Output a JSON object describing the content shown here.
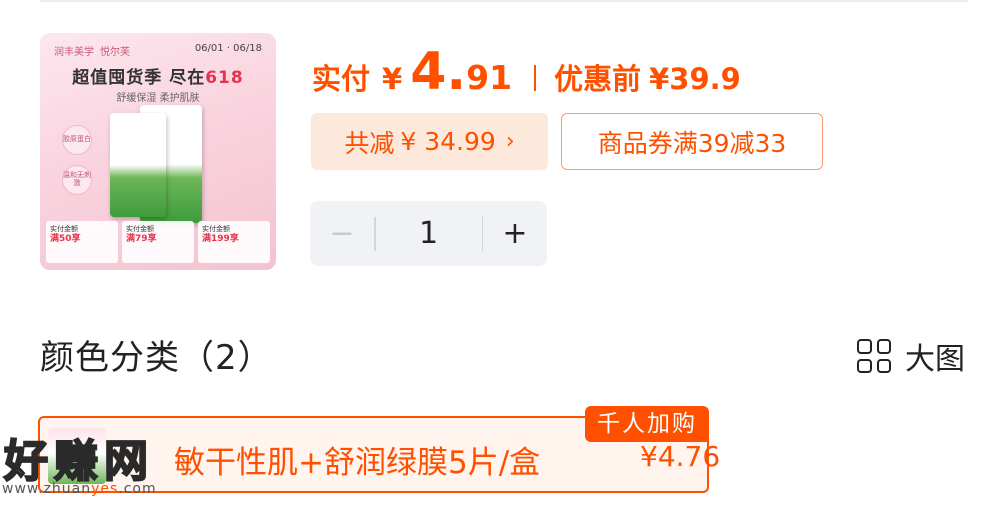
{
  "product_image": {
    "brand_left": "润丰美学",
    "brand_right": "悦尔芙",
    "dates": "06/01 · 06/18",
    "headline_prefix": "超值囤货季 尽在",
    "headline_highlight": "618",
    "subline": "舒缓保湿 柔护肌肤",
    "bubble_1": "胶原蛋白",
    "bubble_2": "温和无刺激",
    "promos": [
      {
        "line1": "实付金额",
        "line2": "满50享"
      },
      {
        "line1": "实付金额",
        "line2": "满79享"
      },
      {
        "line1": "实付金额",
        "line2": "满199享"
      }
    ]
  },
  "price": {
    "label": "实付",
    "currency": "¥",
    "integer": "4.",
    "decimal": "91",
    "original_label": "优惠前",
    "original_value": "¥39.9",
    "color": "#ff5000"
  },
  "discount": {
    "label": "共减",
    "amount": "¥ 34.99",
    "chevron": "›"
  },
  "coupon": {
    "label": "商品券满39减33"
  },
  "quantity": {
    "minus": "−",
    "value": "1",
    "plus": "+"
  },
  "section": {
    "title": "颜色分类（2）",
    "view_label": "大图",
    "view_icon": "grid-icon"
  },
  "variant": {
    "name": "敏干性肌+舒润绿膜5片/盒",
    "price": "¥4.76",
    "badge": "千人加购"
  },
  "watermark": {
    "text": "好赚网",
    "url_prefix": "www.zhuan",
    "url_accent": "yes",
    "url_suffix": ".com"
  }
}
